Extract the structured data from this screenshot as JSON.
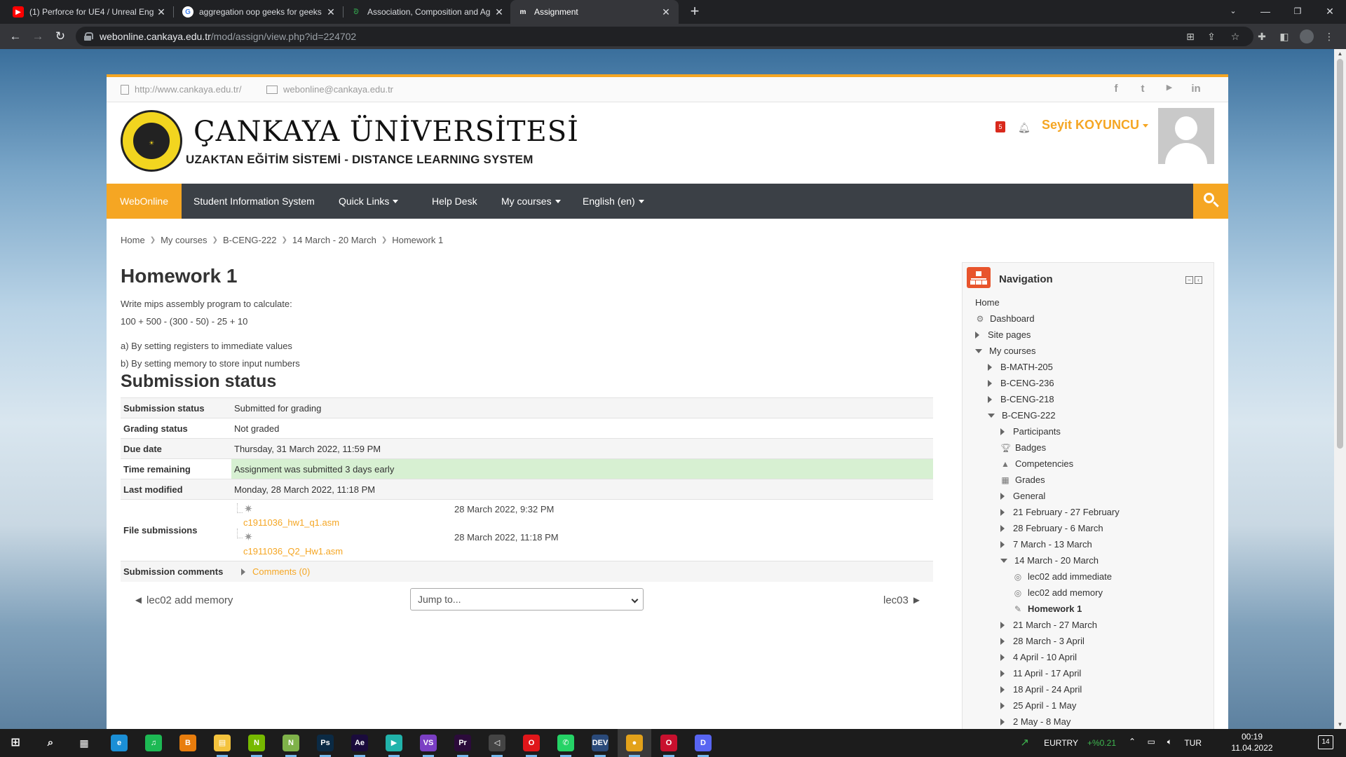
{
  "browser": {
    "tabs": [
      {
        "title": "(1) Perforce for UE4 / Unreal Eng",
        "icon": "youtube-icon",
        "color": "#ff0000"
      },
      {
        "title": "aggregation oop geeks for geeks",
        "icon": "google-icon",
        "color": "#4285f4"
      },
      {
        "title": "Association, Composition and Ag",
        "icon": "geeksforgeeks-icon",
        "color": "#2f8d46"
      },
      {
        "title": "Assignment",
        "icon": "moodle-icon",
        "color": "#ffffff"
      }
    ],
    "new_tab": "+",
    "url_domain": "webonline.cankaya.edu.tr",
    "url_path": "/mod/assign/view.php?id=224702"
  },
  "site": {
    "top_link_url": "http://www.cankaya.edu.tr/",
    "top_link_email": "webonline@cankaya.edu.tr",
    "social": [
      "f",
      "t",
      "▶",
      "in"
    ],
    "logo_alt": "ÇANKAYA ÜNİVERSİTESİ",
    "uni_title": "ÇANKAYA ÜNİVERSİTESİ",
    "uni_subtitle": "UZAKTAN EĞİTİM SİSTEMİ - DISTANCE LEARNING SYSTEM",
    "notif_count": "5",
    "username": "Seyit KOYUNCU",
    "brand_color": "#f5a623"
  },
  "navbar": {
    "items": [
      "WebOnline",
      "Student Information System",
      "Quick Links",
      "Help Desk",
      "My courses",
      "English (en)"
    ]
  },
  "breadcrumb": [
    "Home",
    "My courses",
    "B-CENG-222",
    "14 March - 20 March",
    "Homework 1"
  ],
  "assignment": {
    "title": "Homework 1",
    "desc1": "Write mips assembly program to calculate:",
    "desc2": "100 + 500 - (300 - 50) - 25 + 10",
    "desc3": "a) By setting registers to immediate values",
    "desc4": "b) By setting memory to store input numbers"
  },
  "submission": {
    "heading": "Submission status",
    "rows": [
      {
        "k": "Submission status",
        "v": "Submitted for grading"
      },
      {
        "k": "Grading status",
        "v": "Not graded"
      },
      {
        "k": "Due date",
        "v": "Thursday, 31 March 2022, 11:59 PM"
      },
      {
        "k": "Time remaining",
        "v": "Assignment was submitted 3 days early"
      },
      {
        "k": "Last modified",
        "v": "Monday, 28 March 2022, 11:18 PM"
      }
    ],
    "files_label": "File submissions",
    "files": [
      {
        "name": "c1911036_hw1_q1.asm",
        "date": "28 March 2022, 9:32 PM"
      },
      {
        "name": "c1911036_Q2_Hw1.asm",
        "date": "28 March 2022, 11:18 PM"
      }
    ],
    "comments_label": "Submission comments",
    "comments_link": "Comments (0)"
  },
  "pager": {
    "prev": "◄ lec02 add memory",
    "jump": "Jump to...",
    "next": "lec03 ►"
  },
  "navigation": {
    "title": "Navigation",
    "items": [
      {
        "label": "Home",
        "depth": 0,
        "type": "none"
      },
      {
        "label": "Dashboard",
        "depth": 0,
        "type": "icon",
        "icon": "dashboard-icon"
      },
      {
        "label": "Site pages",
        "depth": 0,
        "type": "right"
      },
      {
        "label": "My courses",
        "depth": 0,
        "type": "down"
      },
      {
        "label": "B-MATH-205",
        "depth": 1,
        "type": "right"
      },
      {
        "label": "B-CENG-236",
        "depth": 1,
        "type": "right"
      },
      {
        "label": "B-CENG-218",
        "depth": 1,
        "type": "right"
      },
      {
        "label": "B-CENG-222",
        "depth": 1,
        "type": "down"
      },
      {
        "label": "Participants",
        "depth": 2,
        "type": "right"
      },
      {
        "label": "Badges",
        "depth": 2,
        "type": "icon",
        "icon": "badge-icon"
      },
      {
        "label": "Competencies",
        "depth": 2,
        "type": "icon",
        "icon": "competencies-icon"
      },
      {
        "label": "Grades",
        "depth": 2,
        "type": "icon",
        "icon": "grades-icon"
      },
      {
        "label": "General",
        "depth": 2,
        "type": "right"
      },
      {
        "label": "21 February - 27 February",
        "depth": 2,
        "type": "right"
      },
      {
        "label": "28 February - 6 March",
        "depth": 2,
        "type": "right"
      },
      {
        "label": "7 March - 13 March",
        "depth": 2,
        "type": "right"
      },
      {
        "label": "14 March - 20 March",
        "depth": 2,
        "type": "down"
      },
      {
        "label": "lec02 add immediate",
        "depth": 3,
        "type": "icon",
        "icon": "file-icon"
      },
      {
        "label": "lec02 add memory",
        "depth": 3,
        "type": "icon",
        "icon": "file-icon"
      },
      {
        "label": "Homework 1",
        "depth": 3,
        "type": "icon",
        "icon": "assignment-icon",
        "bold": true
      },
      {
        "label": "21 March - 27 March",
        "depth": 2,
        "type": "right"
      },
      {
        "label": "28 March - 3 April",
        "depth": 2,
        "type": "right"
      },
      {
        "label": "4 April - 10 April",
        "depth": 2,
        "type": "right"
      },
      {
        "label": "11 April - 17 April",
        "depth": 2,
        "type": "right"
      },
      {
        "label": "18 April - 24 April",
        "depth": 2,
        "type": "right"
      },
      {
        "label": "25 April - 1 May",
        "depth": 2,
        "type": "right"
      },
      {
        "label": "2 May - 8 May",
        "depth": 2,
        "type": "right"
      }
    ]
  },
  "taskbar": {
    "apps": [
      {
        "name": "edge-icon",
        "label": "e",
        "color": "#1b8fd6"
      },
      {
        "name": "spotify-icon",
        "label": "♫",
        "color": "#1db954"
      },
      {
        "name": "blender-icon",
        "label": "B",
        "color": "#e87d0d"
      },
      {
        "name": "file-explorer-icon",
        "label": "▤",
        "color": "#f4c33d"
      },
      {
        "name": "nvidia-icon",
        "label": "N",
        "color": "#76b900"
      },
      {
        "name": "notepad-icon",
        "label": "N",
        "color": "#7fb24a"
      },
      {
        "name": "photoshop-icon",
        "label": "Ps",
        "color": "#0b2a44"
      },
      {
        "name": "after-effects-icon",
        "label": "Ae",
        "color": "#1a0b3c"
      },
      {
        "name": "pycharm-icon",
        "label": "▶",
        "color": "#21b3ab"
      },
      {
        "name": "visual-studio-icon",
        "label": "VS",
        "color": "#7b3fc4"
      },
      {
        "name": "premiere-icon",
        "label": "Pr",
        "color": "#2b0b3a"
      },
      {
        "name": "unity-icon",
        "label": "◁",
        "color": "#444444"
      },
      {
        "name": "opera-icon",
        "label": "O",
        "color": "#e0161a"
      },
      {
        "name": "whatsapp-icon",
        "label": "✆",
        "color": "#25d366"
      },
      {
        "name": "devcpp-icon",
        "label": "DEV",
        "color": "#2a4a7a"
      },
      {
        "name": "chrome-icon",
        "label": "●",
        "color": "#e3a21a"
      },
      {
        "name": "opera-gx-icon",
        "label": "O",
        "color": "#c8102e"
      },
      {
        "name": "discord-icon",
        "label": "D",
        "color": "#5865f2"
      }
    ],
    "ticker": "EURTRY",
    "ticker_change": "+%0.21",
    "lang": "TUR",
    "time": "00:19",
    "date": "11.04.2022",
    "notif": "14"
  }
}
